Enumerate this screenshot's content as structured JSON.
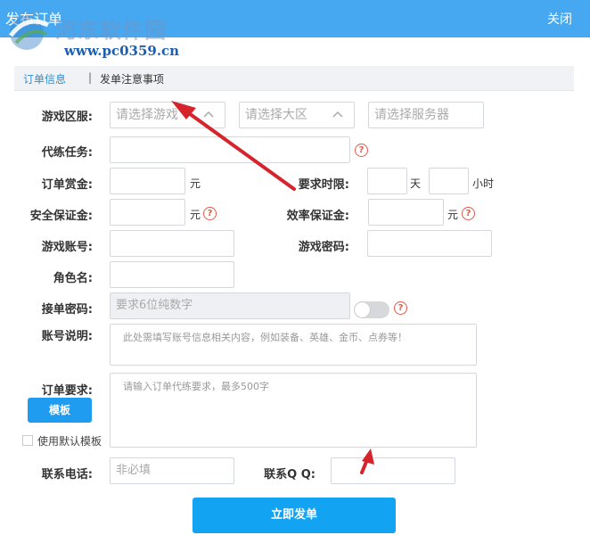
{
  "window": {
    "title": "发布订单",
    "close_label": "关闭"
  },
  "watermark": {
    "name": "河东软件园",
    "url": "www.pc0359.cn"
  },
  "tabs": [
    {
      "label": "订单信息",
      "active": true
    },
    {
      "label": "发单注意事项",
      "active": false
    }
  ],
  "tab_separator": "|",
  "form": {
    "server": {
      "label": "游戏区服:",
      "selects": [
        {
          "placeholder": "请选择游戏"
        },
        {
          "placeholder": "请选择大区"
        },
        {
          "placeholder": "请选择服务器"
        }
      ]
    },
    "task": {
      "label": "代练任务:",
      "value": ""
    },
    "reward": {
      "label": "订单赏金:",
      "unit": "元"
    },
    "time": {
      "label": "要求时限:",
      "day_unit": "天",
      "hour_unit": "小时"
    },
    "safety_deposit": {
      "label": "安全保证金:",
      "unit": "元"
    },
    "efficiency_deposit": {
      "label": "效率保证金:",
      "unit": "元"
    },
    "account": {
      "label": "游戏账号:"
    },
    "password": {
      "label": "游戏密码:"
    },
    "role": {
      "label": "角色名:"
    },
    "accept_password": {
      "label": "接单密码:",
      "placeholder": "要求6位纯数字",
      "toggle_on": false
    },
    "account_note": {
      "label": "账号说明:",
      "placeholder": "此处需填写账号信息相关内容，例如装备、英雄、金币、点券等！"
    },
    "requirements": {
      "label": "订单要求:",
      "placeholder": "请输入订单代练要求，最多500字",
      "template_button": "模板",
      "default_template_label": "使用默认模板",
      "default_template_checked": false
    },
    "phone": {
      "label": "联系电话:",
      "placeholder": "非必填"
    },
    "qq": {
      "label": "联系Q Q:"
    },
    "help_icon": "?"
  },
  "submit_label": "立即发单",
  "colors": {
    "titlebar": "#45a8f0",
    "accent": "#1f9bf0",
    "tab_active": "#2d8fd8",
    "help": "#e05a4a",
    "arrow": "#d6242c"
  }
}
